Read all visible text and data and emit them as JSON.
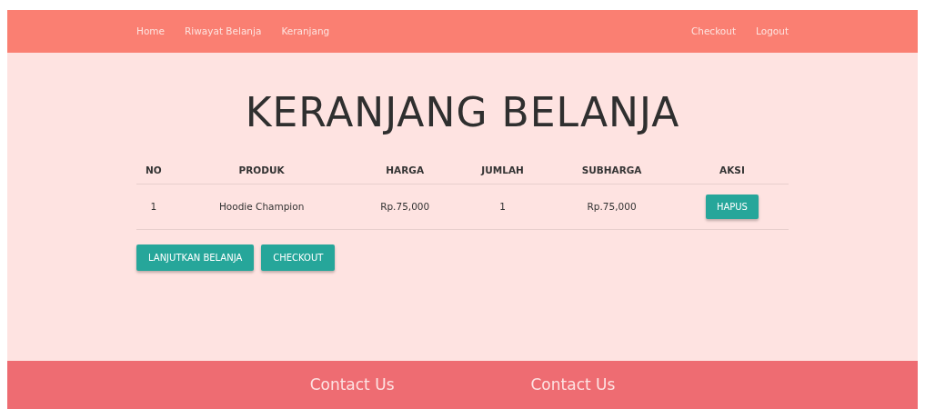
{
  "navbar": {
    "left_links": [
      "Home",
      "Riwayat Belanja",
      "Keranjang"
    ],
    "right_links": [
      "Checkout",
      "Logout"
    ]
  },
  "title": "KERANJANG BELANJA",
  "table": {
    "columns": [
      "NO",
      "PRODUK",
      "HARGA",
      "JUMLAH",
      "SUBHARGA",
      "AKSI"
    ],
    "rows": [
      {
        "no": "1",
        "produk": "Hoodie Champion",
        "harga": "Rp.75,000",
        "jumlah": "1",
        "subharga": "Rp.75,000",
        "action": "HAPUS"
      }
    ]
  },
  "buttons": [
    "LANJUTKAN BELANJA",
    "CHECKOUT"
  ],
  "footer": {
    "headings": [
      "Contact Us",
      "Contact Us"
    ]
  }
}
